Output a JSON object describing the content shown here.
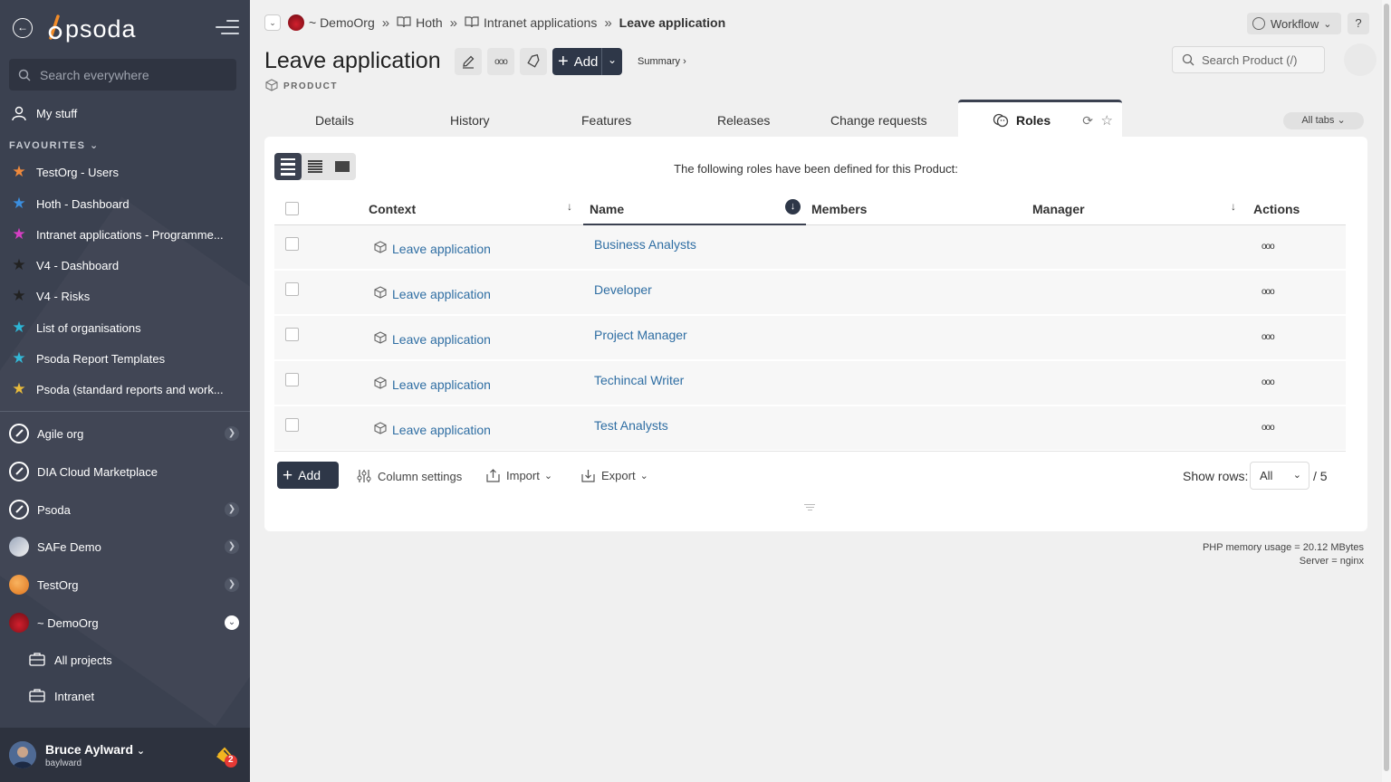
{
  "sidebar": {
    "brand": "psoda",
    "search_placeholder": "Search everywhere",
    "my_stuff": "My stuff",
    "favourites_heading": "FAVOURITES",
    "favourites": [
      {
        "label": "TestOrg - Users",
        "color": "#f08a3c"
      },
      {
        "label": "Hoth - Dashboard",
        "color": "#3b8fe0"
      },
      {
        "label": "Intranet applications - Programme...",
        "color": "#d63fc4"
      },
      {
        "label": "V4 - Dashboard",
        "color": "#222222"
      },
      {
        "label": "V4 - Risks",
        "color": "#222222"
      },
      {
        "label": "List of organisations",
        "color": "#2db6d6"
      },
      {
        "label": "Psoda Report Templates",
        "color": "#2db6d6"
      },
      {
        "label": "Psoda (standard reports and work...",
        "color": "#e8b936"
      }
    ],
    "orgs": [
      {
        "label": "Agile org"
      },
      {
        "label": "DIA Cloud Marketplace"
      },
      {
        "label": "Psoda"
      },
      {
        "label": "SAFe Demo"
      },
      {
        "label": "TestOrg"
      },
      {
        "label": "~ DemoOrg"
      }
    ],
    "sub_items": [
      {
        "label": "All projects"
      },
      {
        "label": "Intranet"
      }
    ],
    "user": {
      "name": "Bruce Aylward",
      "username": "baylward",
      "notifications": "2"
    }
  },
  "breadcrumb": {
    "items": [
      "~ DemoOrg",
      "Hoth",
      "Intranet applications"
    ],
    "current": "Leave application"
  },
  "header": {
    "workflow_label": "Workflow",
    "help_label": "?",
    "title": "Leave application",
    "type_label": "PRODUCT",
    "add_label": "Add",
    "summary_label": "Summary ›",
    "search_placeholder": "Search Product (/)"
  },
  "tabs": {
    "items": [
      "Details",
      "History",
      "Features",
      "Releases",
      "Change requests"
    ],
    "active": "Roles",
    "all_tabs_label": "All tabs"
  },
  "panel": {
    "intro": "The following roles have been defined for this Product:",
    "columns": {
      "context": "Context",
      "name": "Name",
      "members": "Members",
      "manager": "Manager",
      "actions": "Actions"
    },
    "rows": [
      {
        "context": "Leave application",
        "name": "Business Analysts"
      },
      {
        "context": "Leave application",
        "name": "Developer"
      },
      {
        "context": "Leave application",
        "name": "Project Manager"
      },
      {
        "context": "Leave application",
        "name": "Techincal Writer"
      },
      {
        "context": "Leave application",
        "name": "Test Analysts"
      }
    ],
    "actions_glyph": "ooo",
    "add_label": "Add",
    "column_settings_label": "Column settings",
    "import_label": "Import",
    "export_label": "Export",
    "show_rows_label": "Show rows:",
    "show_rows_value": "All",
    "rows_total": "/ 5"
  },
  "server_info": {
    "memory": "PHP memory usage = 20.12 MBytes",
    "server": "Server = nginx"
  }
}
